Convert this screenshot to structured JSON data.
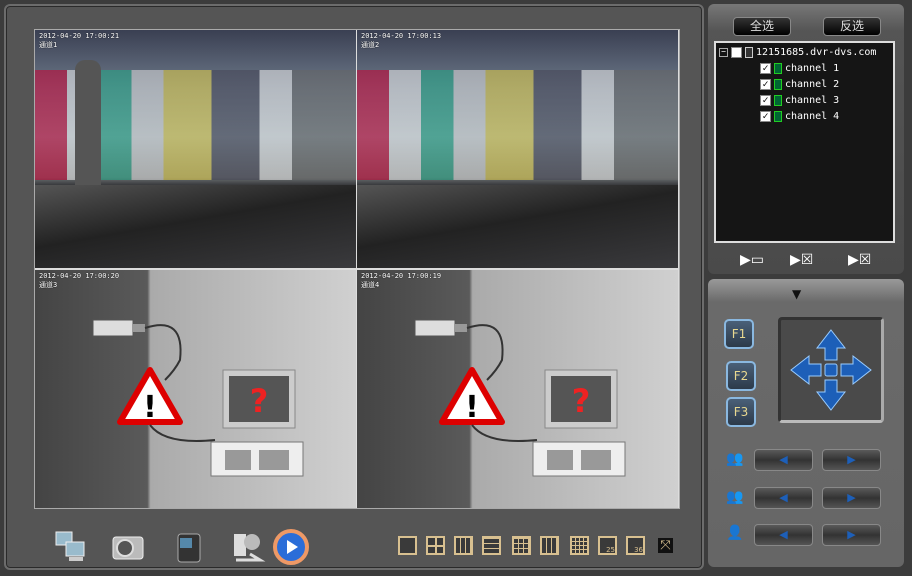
{
  "video": {
    "channels": [
      {
        "timestamp": "2012-04-20 17:00:21",
        "label": "通道1"
      },
      {
        "timestamp": "2012-04-20 17:00:13",
        "label": "通道2"
      },
      {
        "timestamp": "2012-04-20 17:00:20",
        "label": "通道3"
      },
      {
        "timestamp": "2012-04-20 17:00:19",
        "label": "通道4"
      }
    ]
  },
  "toolbar": {
    "icons": [
      "network-computers-icon",
      "camera-snapshot-icon",
      "video-camcorder-icon",
      "webcam-icon",
      "media-player-icon"
    ],
    "layouts": [
      "1",
      "4",
      "6",
      "8",
      "9",
      "13",
      "16",
      "25",
      "36",
      "fullscreen"
    ],
    "layout_25": "25",
    "layout_36": "36"
  },
  "side": {
    "select_all": "全选",
    "invert_select": "反选",
    "device": "12151685.dvr-dvs.com",
    "channels": [
      "channel 1",
      "channel 2",
      "channel 3",
      "channel 4"
    ],
    "ptz": {
      "f1": "F1",
      "f2": "F2",
      "f3": "F3"
    }
  },
  "colors": {
    "accent": "#1d5fb8",
    "tree_bg": "#151515",
    "channel_icon": "#22cc22"
  }
}
